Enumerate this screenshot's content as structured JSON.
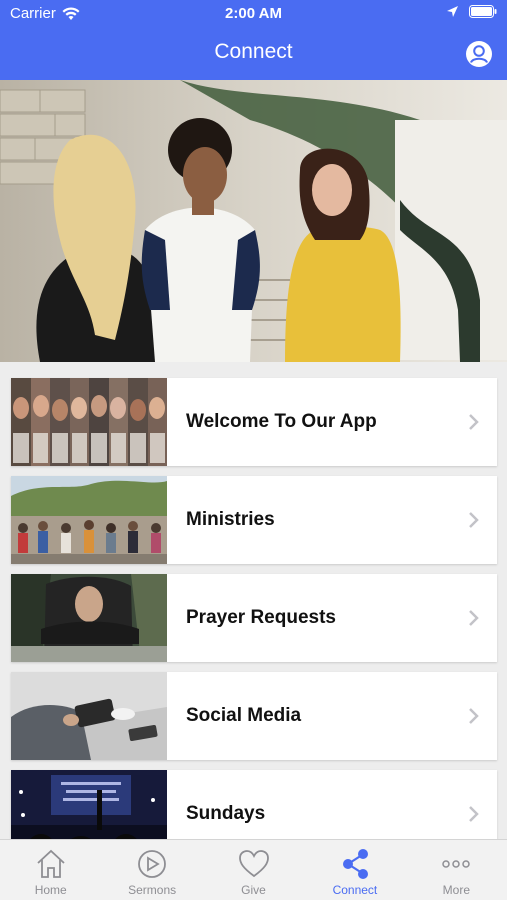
{
  "status": {
    "carrier": "Carrier",
    "time": "2:00 AM"
  },
  "header": {
    "title": "Connect"
  },
  "items": [
    {
      "label": "Welcome To Our App"
    },
    {
      "label": "Ministries"
    },
    {
      "label": "Prayer Requests"
    },
    {
      "label": "Social Media"
    },
    {
      "label": "Sundays"
    }
  ],
  "tabs": [
    {
      "label": "Home",
      "icon": "home-icon"
    },
    {
      "label": "Sermons",
      "icon": "play-icon"
    },
    {
      "label": "Give",
      "icon": "heart-icon"
    },
    {
      "label": "Connect",
      "icon": "share-icon",
      "active": true
    },
    {
      "label": "More",
      "icon": "more-icon"
    }
  ],
  "colors": {
    "accent": "#4a6cf2",
    "inactive": "#8e8e93"
  }
}
